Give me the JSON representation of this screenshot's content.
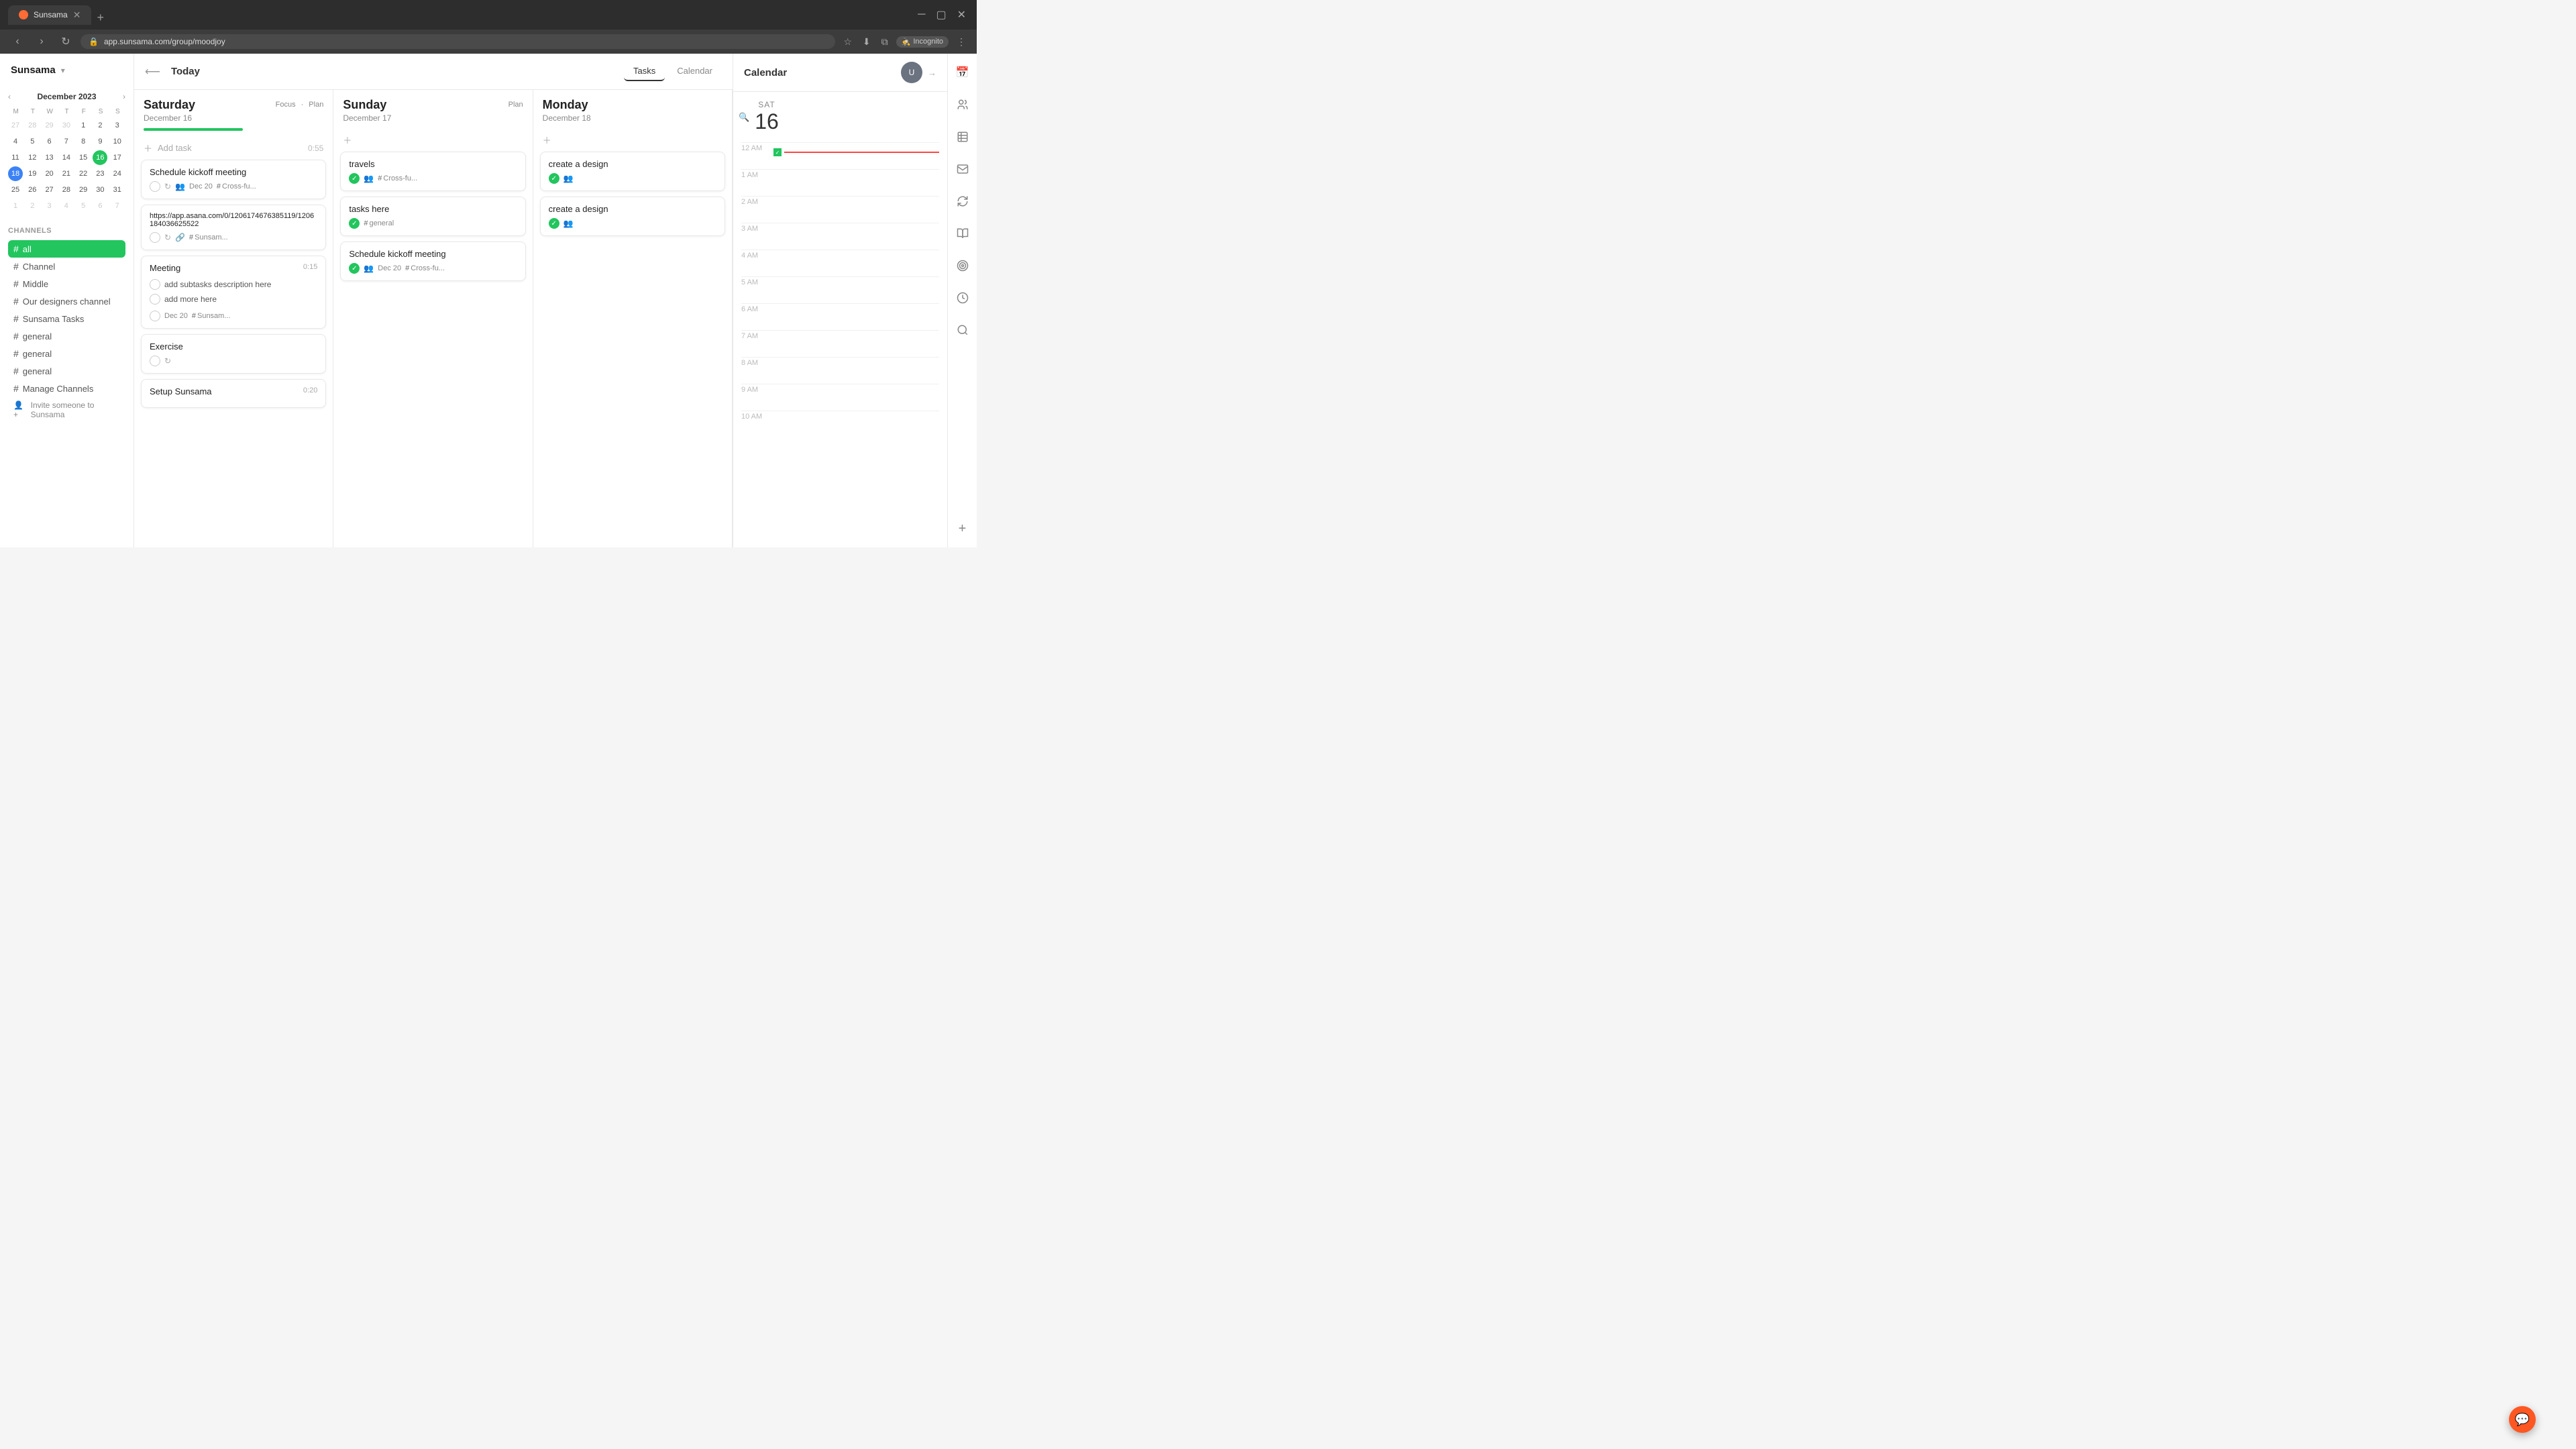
{
  "browser": {
    "tab_title": "Sunsama",
    "url": "app.sunsama.com/group/moodjoy",
    "incognito_label": "Incognito"
  },
  "sidebar": {
    "logo": "Sunsama",
    "calendar": {
      "month_year": "December 2023",
      "day_headers": [
        "M",
        "T",
        "W",
        "T",
        "F",
        "S",
        "S"
      ],
      "weeks": [
        [
          "27",
          "28",
          "29",
          "30",
          "1",
          "2",
          "3"
        ],
        [
          "4",
          "5",
          "6",
          "7",
          "8",
          "9",
          "10"
        ],
        [
          "11",
          "12",
          "13",
          "14",
          "15",
          "16",
          "17"
        ],
        [
          "18",
          "19",
          "20",
          "21",
          "22",
          "23",
          "24"
        ],
        [
          "25",
          "26",
          "27",
          "28",
          "29",
          "30",
          "31"
        ],
        [
          "1",
          "2",
          "3",
          "4",
          "5",
          "6",
          "7"
        ]
      ],
      "today": "16",
      "selected": "18"
    },
    "channels_title": "CHANNELS",
    "channels": [
      {
        "name": "all",
        "active": true
      },
      {
        "name": "Channel",
        "active": false
      },
      {
        "name": "Middle",
        "active": false
      },
      {
        "name": "Our designers channel",
        "active": false
      },
      {
        "name": "Sunsama Tasks",
        "active": false
      },
      {
        "name": "general",
        "active": false
      },
      {
        "name": "general",
        "active": false
      },
      {
        "name": "general",
        "active": false
      },
      {
        "name": "Manage Channels",
        "active": false
      }
    ],
    "invite_label": "Invite someone to Sunsama"
  },
  "main": {
    "today_btn": "Today",
    "tabs": [
      {
        "label": "Tasks",
        "active": true
      },
      {
        "label": "Calendar",
        "active": false
      }
    ],
    "days": [
      {
        "name": "Saturday",
        "date": "December 16",
        "actions": [
          "Focus",
          "Plan"
        ],
        "has_progress": true,
        "tasks": [
          {
            "id": "t1",
            "title": "Schedule kickoff meeting",
            "done": false,
            "has_repeat": true,
            "has_users": true,
            "date": "Dec 20",
            "tag": "Cross-fu...",
            "time": ""
          },
          {
            "id": "t2",
            "title": "https://app.asana.com/0/1206174676385119/1206184036625522",
            "done": false,
            "has_repeat": true,
            "has_link": true,
            "date": "",
            "tag": "Sunsam...",
            "time": ""
          },
          {
            "id": "t3",
            "title": "Meeting",
            "done": false,
            "time": "0:15",
            "subtasks": [
              {
                "text": "add subtasks description here",
                "done": false
              },
              {
                "text": "add more here",
                "done": false
              }
            ],
            "date": "Dec 20",
            "tag": "Sunsam..."
          },
          {
            "id": "t4",
            "title": "Exercise",
            "done": false,
            "has_repeat": true,
            "date": "",
            "tag": ""
          },
          {
            "id": "t5",
            "title": "Setup Sunsama",
            "done": false,
            "time": "0:20"
          }
        ],
        "add_task_time": "0:55"
      },
      {
        "name": "Sunday",
        "date": "December 17",
        "actions": [
          "Plan"
        ],
        "has_progress": false,
        "tasks": [
          {
            "id": "s1",
            "title": "travels",
            "done": true,
            "has_users": true,
            "date": "",
            "tag": "Cross-fu..."
          },
          {
            "id": "s2",
            "title": "tasks here",
            "done": true,
            "date": "",
            "tag": "general"
          },
          {
            "id": "s3",
            "title": "Schedule kickoff meeting",
            "done": true,
            "has_users": true,
            "date": "Dec 20",
            "tag": "Cross-fu..."
          }
        ]
      },
      {
        "name": "Monday",
        "date": "December 18",
        "actions": [],
        "has_progress": false,
        "tasks": [
          {
            "id": "m1",
            "title": "create a design",
            "done": true,
            "has_users": true,
            "date": "",
            "tag": ""
          },
          {
            "id": "m2",
            "title": "create a design",
            "done": true,
            "has_users": true,
            "date": "",
            "tag": ""
          }
        ]
      }
    ]
  },
  "right_panel": {
    "title": "Calendar",
    "day_label": "SAT",
    "day_num": "16",
    "time_slots": [
      "12 AM",
      "1 AM",
      "2 AM",
      "3 AM",
      "4 AM",
      "5 AM",
      "6 AM",
      "7 AM",
      "8 AM",
      "9 AM",
      "10 AM"
    ]
  },
  "right_sidebar": {
    "icons": [
      "grid",
      "users",
      "table",
      "mail",
      "refresh",
      "notebook",
      "target",
      "clock",
      "search",
      "add"
    ]
  },
  "fab": {
    "label": "💬"
  }
}
